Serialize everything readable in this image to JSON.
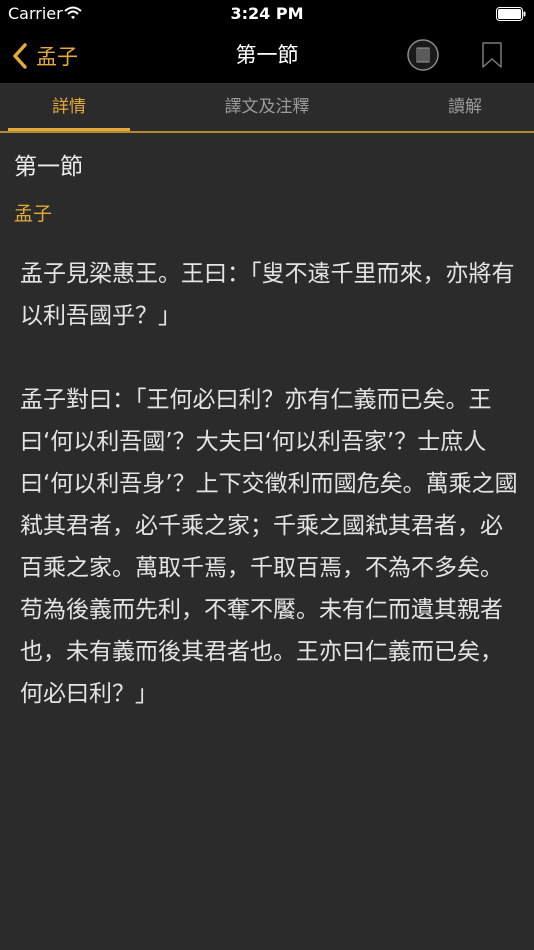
{
  "status_bar": {
    "carrier": "Carrier",
    "time": "3:24 PM"
  },
  "nav": {
    "back_label": "孟子",
    "title": "第一節"
  },
  "tabs": [
    {
      "label": "詳情",
      "active": true
    },
    {
      "label": "譯文及注釋",
      "active": false
    },
    {
      "label": "讀解",
      "active": false
    }
  ],
  "content": {
    "section_title": "第一節",
    "book_name": "孟子",
    "paragraphs": [
      "孟子見梁惠王。王曰：「叟不遠千里而來，亦將有以利吾國乎？」",
      "孟子對曰：「王何必曰利？亦有仁義而已矣。王曰‘何以利吾國’？大夫曰‘何以利吾家’？士庶人曰‘何以利吾身’？上下交徵利而國危矣。萬乘之國弒其君者，必千乘之家；千乘之國弒其君者，必百乘之家。萬取千焉，千取百焉，不為不多矣。苟為後義而先利，不奪不饜。未有仁而遺其親者也，未有義而後其君者也。王亦曰仁義而已矣，何必曰利？」"
    ]
  },
  "colors": {
    "accent": "#e2a93b",
    "background": "#2b2b2b",
    "bar": "#000000",
    "text": "#e4e4e4",
    "inactive_tab": "#9a9a9a"
  }
}
